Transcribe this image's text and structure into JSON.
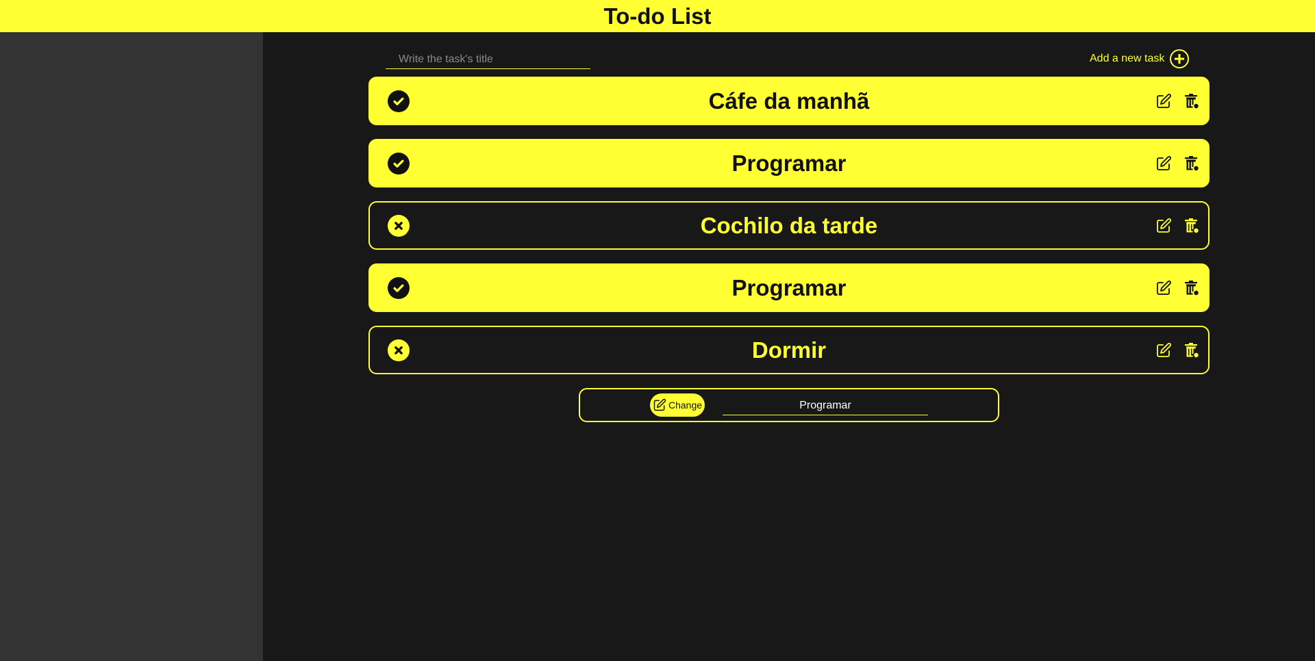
{
  "header": {
    "title": "To-do List"
  },
  "new_task": {
    "placeholder": "Write the task's title",
    "value": "",
    "add_label": "Add a new task"
  },
  "tasks": [
    {
      "title": "Cáfe da manhã",
      "status": "done"
    },
    {
      "title": "Programar",
      "status": "done"
    },
    {
      "title": "Cochilo da tarde",
      "status": "pending"
    },
    {
      "title": "Programar",
      "status": "done"
    },
    {
      "title": "Dormir",
      "status": "pending"
    }
  ],
  "edit": {
    "button_label": "Change",
    "value": "Programar"
  },
  "icons": {
    "status_done": "check-circle-icon",
    "status_pending": "x-circle-icon",
    "edit": "pencil-square-icon",
    "delete": "trash-icon",
    "add": "plus-circle-icon"
  },
  "colors": {
    "accent": "#ffff33",
    "background": "#181818",
    "sidebar": "#333333",
    "dark_text": "#111111"
  }
}
